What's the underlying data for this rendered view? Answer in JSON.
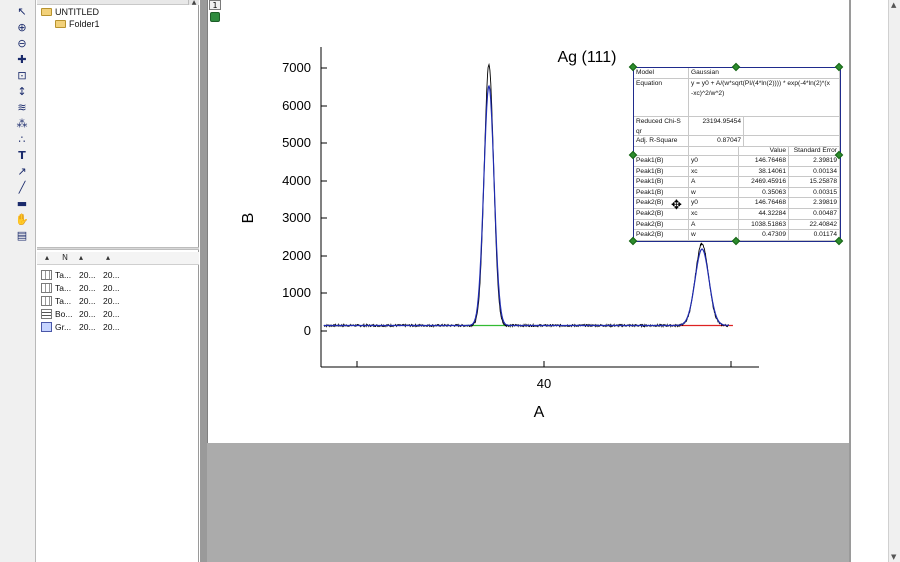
{
  "explorer": {
    "root": "UNTITLED",
    "folder": "Folder1",
    "list_header": {
      "name_col": "N"
    },
    "items": [
      {
        "icon": "table-icon",
        "name": "Ta...",
        "col2": "20...",
        "col3": "20..."
      },
      {
        "icon": "table-icon",
        "name": "Ta...",
        "col2": "20...",
        "col3": "20..."
      },
      {
        "icon": "table-icon",
        "name": "Ta...",
        "col2": "20...",
        "col3": "20..."
      },
      {
        "icon": "book-icon",
        "name": "Bo...",
        "col2": "20...",
        "col3": "20..."
      },
      {
        "icon": "graph-icon",
        "name": "Gr...",
        "col2": "20...",
        "col3": "20..."
      }
    ]
  },
  "graph": {
    "layer_tab": "1",
    "title": "Ag (111)",
    "xlabel": "A",
    "ylabel": "B"
  },
  "chart_data": {
    "type": "line",
    "title": "Ag (111)",
    "xlabel": "A",
    "ylabel": "B",
    "xlim": [
      33,
      49
    ],
    "ylim": [
      -1000,
      7500
    ],
    "x_ticks": [
      40
    ],
    "y_ticks": [
      0,
      1000,
      2000,
      3000,
      4000,
      5000,
      6000,
      7000
    ],
    "series": [
      {
        "role": "data",
        "peaks": [
          {
            "center": 38.14,
            "height": 7100
          },
          {
            "center": 44.32,
            "height": 2330
          }
        ],
        "baseline": 146.8
      },
      {
        "role": "fit",
        "peaks": [
          {
            "center": 38.14061,
            "height": 6520
          },
          {
            "center": 44.32284,
            "height": 2180
          }
        ],
        "baseline": 146.76
      }
    ]
  },
  "fit_table": {
    "model_label": "Model",
    "model_value": "Gaussian",
    "equation_label": "Equation",
    "equation_value_1": "y = y0 + A/(w*sqrt(PI/(4*ln(2)))) * exp(-4*ln(2)*(x",
    "equation_value_2": "-xc)^2/w^2)",
    "chi_label_1": "Reduced Chi-S",
    "chi_label_2": "qr",
    "chi_value": "23194.95454",
    "r2_label": "Adj. R-Square",
    "r2_value": "0.87047",
    "col_value": "Value",
    "col_error": "Standard Error",
    "rows": [
      {
        "peak": "Peak1(B)",
        "param": "y0",
        "value": "146.76468",
        "error": "2.39819"
      },
      {
        "peak": "Peak1(B)",
        "param": "xc",
        "value": "38.14061",
        "error": "0.00134"
      },
      {
        "peak": "Peak1(B)",
        "param": "A",
        "value": "2469.45916",
        "error": "15.25878"
      },
      {
        "peak": "Peak1(B)",
        "param": "w",
        "value": "0.35063",
        "error": "0.00315"
      },
      {
        "peak": "Peak2(B)",
        "param": "y0",
        "value": "146.76468",
        "error": "2.39819"
      },
      {
        "peak": "Peak2(B)",
        "param": "xc",
        "value": "44.32284",
        "error": "0.00487"
      },
      {
        "peak": "Peak2(B)",
        "param": "A",
        "value": "1038.51863",
        "error": "22.40842"
      },
      {
        "peak": "Peak2(B)",
        "param": "w",
        "value": "0.47309",
        "error": "0.01174"
      }
    ]
  },
  "colors": {
    "data": "#000000",
    "fit": "#1f2bb0",
    "base1": "#33bb33",
    "base2": "#dd2222",
    "handle": "#2d8c2d"
  }
}
